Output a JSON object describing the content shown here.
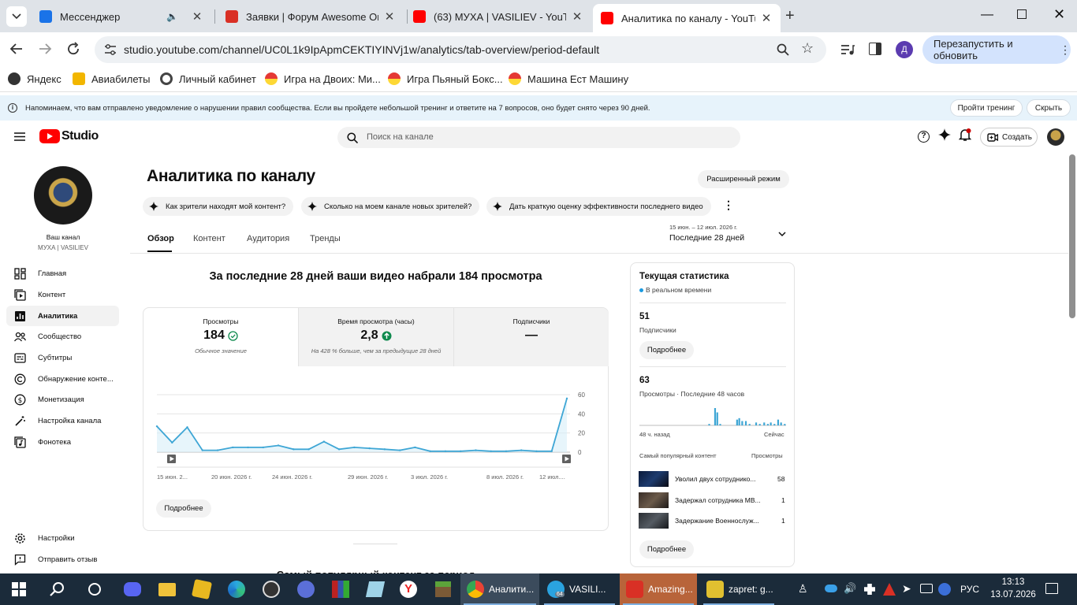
{
  "browser": {
    "tabs": [
      {
        "title": "Мессенджер",
        "favicon_color": "#1a73e8"
      },
      {
        "title": "Заявки | Форум Awesome Onli",
        "favicon_color": "#d93025"
      },
      {
        "title": "(63) МУХА | VASILIEV - YouTube",
        "favicon_color": "#ff0000"
      },
      {
        "title": "Аналитика по каналу - YouTub",
        "favicon_color": "#ff0000"
      }
    ],
    "url": "studio.youtube.com/channel/UC0L1k9IpApmCEKTIYINVj1w/analytics/tab-overview/period-default",
    "profile_letter": "Д",
    "restart_button": "Перезапустить и обновить",
    "bookmarks": [
      "Яндекс",
      "Авиабилеты",
      "Личный кабинет",
      "Игра на Двоих: Ми...",
      "Игра Пьяный Бокс...",
      "Машина Ест Машину"
    ]
  },
  "notice": {
    "text": "Напоминаем, что вам отправлено уведомление о нарушении правил сообщества. Если вы пройдете небольшой тренинг и ответите на 7 вопросов, оно будет снято через 90 дней.",
    "train_button": "Пройти тренинг",
    "hide_button": "Скрыть"
  },
  "header": {
    "logo_text": "Studio",
    "search_placeholder": "Поиск на канале",
    "create_button": "Создать"
  },
  "sidebar": {
    "channel_label": "Ваш канал",
    "channel_name": "МУХА | VASILIEV",
    "items": [
      {
        "label": "Главная",
        "icon": "dashboard-icon"
      },
      {
        "label": "Контент",
        "icon": "content-icon"
      },
      {
        "label": "Аналитика",
        "icon": "analytics-icon"
      },
      {
        "label": "Сообщество",
        "icon": "community-icon"
      },
      {
        "label": "Субтитры",
        "icon": "subtitles-icon"
      },
      {
        "label": "Обнаружение конте...",
        "icon": "copyright-icon"
      },
      {
        "label": "Монетизация",
        "icon": "monetization-icon"
      },
      {
        "label": "Настройка канала",
        "icon": "customization-icon"
      },
      {
        "label": "Фонотека",
        "icon": "audio-library-icon"
      }
    ],
    "settings": "Настройки",
    "feedback": "Отправить отзыв"
  },
  "main": {
    "title": "Аналитика по каналу",
    "advanced_mode": "Расширенный режим",
    "chips": [
      "Как зрители находят мой контент?",
      "Сколько на моем канале новых зрителей?",
      "Дать краткую оценку эффективности последнего видео"
    ],
    "tabs": [
      "Обзор",
      "Контент",
      "Аудитория",
      "Тренды"
    ],
    "period_range": "15 июн. – 12 июл. 2026 г.",
    "period_label": "Последние 28 дней",
    "summary_heading": "За последние 28 дней ваши видео набрали 184 просмотра",
    "metrics": {
      "views": {
        "label": "Просмотры",
        "value": "184",
        "note": "Обычное значение"
      },
      "watch_time": {
        "label": "Время просмотра (часы)",
        "value": "2,8",
        "note": "На 428 % больше, чем за предыдущие 28 дней"
      },
      "subscribers": {
        "label": "Подписчики",
        "value": "—"
      }
    },
    "more_button": "Подробнее",
    "bottom_heading_partial": "Самый популярный контент за период"
  },
  "chart_data": {
    "type": "line",
    "x": [
      "15 июн. 2...",
      "20 июн. 2026 г.",
      "24 июн. 2026 г.",
      "29 июн. 2026 г.",
      "3 июл. 2026 г.",
      "8 июл. 2026 г.",
      "12 июл...."
    ],
    "y_ticks": [
      60,
      40,
      20,
      0
    ],
    "ylim": [
      0,
      60
    ],
    "series": [
      {
        "values": [
          27,
          10,
          26,
          2,
          2,
          5,
          5,
          5,
          7,
          3,
          3,
          11,
          3,
          5,
          4,
          3,
          2,
          5,
          1,
          1,
          1,
          2,
          1,
          1,
          2,
          1,
          1,
          56
        ]
      }
    ],
    "grid": true
  },
  "realtime": {
    "title": "Текущая статистика",
    "live_label": "В реальном времени",
    "subscribers_value": "51",
    "subscribers_label": "Подписчики",
    "views_value": "63",
    "views_label": "Просмотры · Последние 48 часов",
    "axis_left": "48 ч. назад",
    "axis_right": "Сейчас",
    "bars": [
      0,
      0,
      0,
      0,
      0,
      0,
      0,
      0,
      0,
      0,
      0,
      0,
      0,
      0,
      0,
      0,
      0,
      0,
      0,
      0,
      0,
      0,
      0,
      0,
      0,
      0,
      0,
      0,
      0,
      0,
      0,
      0,
      0,
      0,
      0,
      0,
      0,
      0,
      0,
      0,
      0,
      0,
      0,
      0,
      0,
      0,
      0,
      0,
      0,
      0,
      0,
      0,
      0,
      0,
      0,
      0,
      0,
      0,
      0,
      0,
      0,
      0,
      0,
      0,
      0,
      0,
      0,
      0,
      0,
      0,
      0,
      0,
      0,
      0,
      0,
      0,
      0,
      0,
      0,
      0,
      0,
      0,
      0,
      0,
      0,
      0,
      0,
      0,
      0,
      0,
      0,
      0,
      0,
      0,
      0,
      0,
      0,
      0,
      0,
      0,
      0,
      0,
      0,
      0,
      0,
      0,
      0,
      0,
      0,
      0,
      0,
      0,
      0,
      0,
      0,
      0,
      0,
      0,
      0,
      0,
      0,
      0,
      0,
      0,
      0,
      0,
      0,
      0,
      0,
      0,
      0,
      0,
      0,
      0,
      0,
      0,
      0,
      0,
      0,
      0,
      0,
      0,
      0,
      0,
      0,
      0,
      0,
      0,
      0,
      0,
      0,
      0,
      0,
      0,
      0,
      0,
      0,
      0,
      0,
      0,
      0,
      0,
      0,
      0,
      0,
      0,
      0,
      0,
      0,
      0,
      0,
      0,
      0,
      0,
      0,
      0,
      0,
      0,
      0,
      0
    ],
    "bar_values": [
      {
        "at": 0.47,
        "v": 1
      },
      {
        "at": 0.51,
        "v": 12
      },
      {
        "at": 0.525,
        "v": 9
      },
      {
        "at": 0.545,
        "v": 1
      },
      {
        "at": 0.66,
        "v": 4
      },
      {
        "at": 0.675,
        "v": 5
      },
      {
        "at": 0.695,
        "v": 3
      },
      {
        "at": 0.72,
        "v": 3
      },
      {
        "at": 0.745,
        "v": 1
      },
      {
        "at": 0.79,
        "v": 2
      },
      {
        "at": 0.815,
        "v": 1
      },
      {
        "at": 0.845,
        "v": 2
      },
      {
        "at": 0.87,
        "v": 1
      },
      {
        "at": 0.89,
        "v": 2
      },
      {
        "at": 0.915,
        "v": 1
      },
      {
        "at": 0.94,
        "v": 4
      },
      {
        "at": 0.96,
        "v": 2
      },
      {
        "at": 0.985,
        "v": 1
      }
    ],
    "top_content_label": "Самый популярный контент",
    "top_views_label": "Просмотры",
    "top_videos": [
      {
        "title": "Уволил двух сотруднико...",
        "views": "58"
      },
      {
        "title": "Задержал сотрудника МВ...",
        "views": "1"
      },
      {
        "title": "Задержание Военнослуж...",
        "views": "1"
      }
    ],
    "more_button": "Подробнее"
  },
  "taskbar": {
    "apps": [
      "Аналити...",
      "VASILI...",
      "Amazing...",
      "zapret: g..."
    ],
    "telegram_badge": "64",
    "lang": "РУС",
    "time": "13:13",
    "date": "13.07.2026"
  }
}
